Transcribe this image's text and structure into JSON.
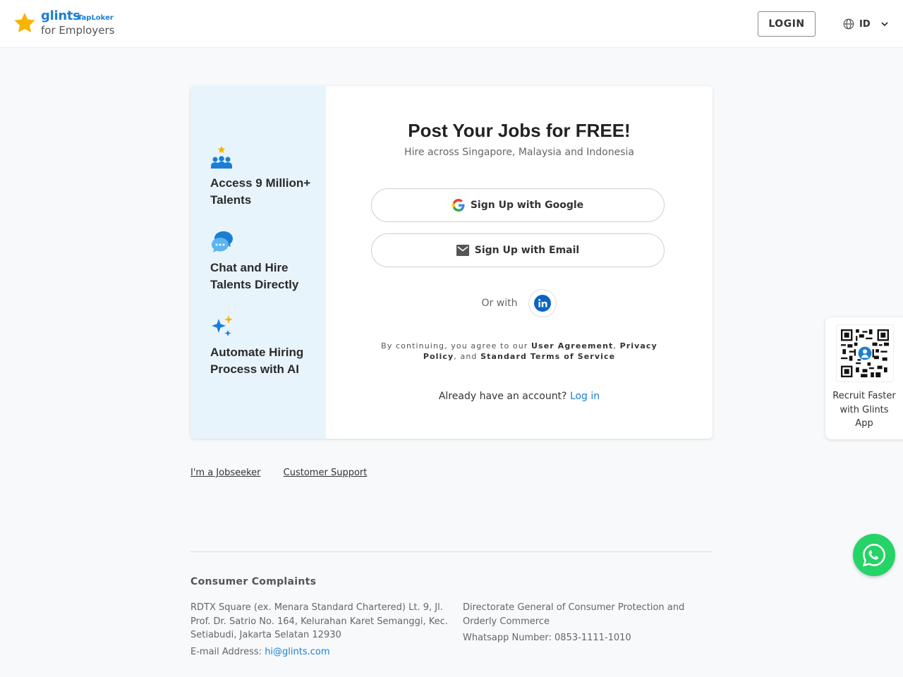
{
  "header": {
    "logo_brand": "glints",
    "logo_sub": "TapLoker",
    "logo_tagline": "for Employers",
    "login_label": "LOGIN",
    "language": "ID"
  },
  "features": [
    {
      "icon": "people-star-icon",
      "text": "Access 9 Million+ Talents"
    },
    {
      "icon": "chat-bubble-icon",
      "text": "Chat and Hire Talents Directly"
    },
    {
      "icon": "sparkle-ai-icon",
      "text": "Automate Hiring Process with AI"
    }
  ],
  "signup": {
    "title": "Post Your Jobs for FREE!",
    "subtitle": "Hire across Singapore, Malaysia and Indonesia",
    "google_label": "Sign Up with Google",
    "email_label": "Sign Up with Email",
    "or_with": "Or with",
    "terms_prefix": "By continuing, you agree to our",
    "terms_user_agreement": "User Agreement",
    "terms_privacy": "Privacy Policy",
    "terms_and": ", and",
    "terms_standard": "Standard Terms of Service",
    "already_text": "Already have an account?",
    "login_link": "Log in"
  },
  "footer_links": {
    "jobseeker": "I'm a Jobseeker",
    "support": "Customer Support"
  },
  "consumer": {
    "title": "Consumer Complaints",
    "address": "RDTX Square (ex. Menara Standard Chartered) Lt. 9, Jl. Prof. Dr. Satrio No. 164, Kelurahan Karet Semanggi, Kec. Setiabudi, Jakarta Selatan 12930",
    "email_label": "E-mail Address:",
    "email": "hi@glints.com",
    "directorate": "Directorate General of Consumer Protection and Orderly Commerce",
    "whatsapp": "Whatsapp Number: 0853-1111-1010"
  },
  "qr_panel": {
    "text": "Recruit Faster with Glints App"
  },
  "colors": {
    "brand": "#1a7fd4",
    "whatsapp": "#25d366",
    "feature_bg": "#e8f4fc"
  }
}
